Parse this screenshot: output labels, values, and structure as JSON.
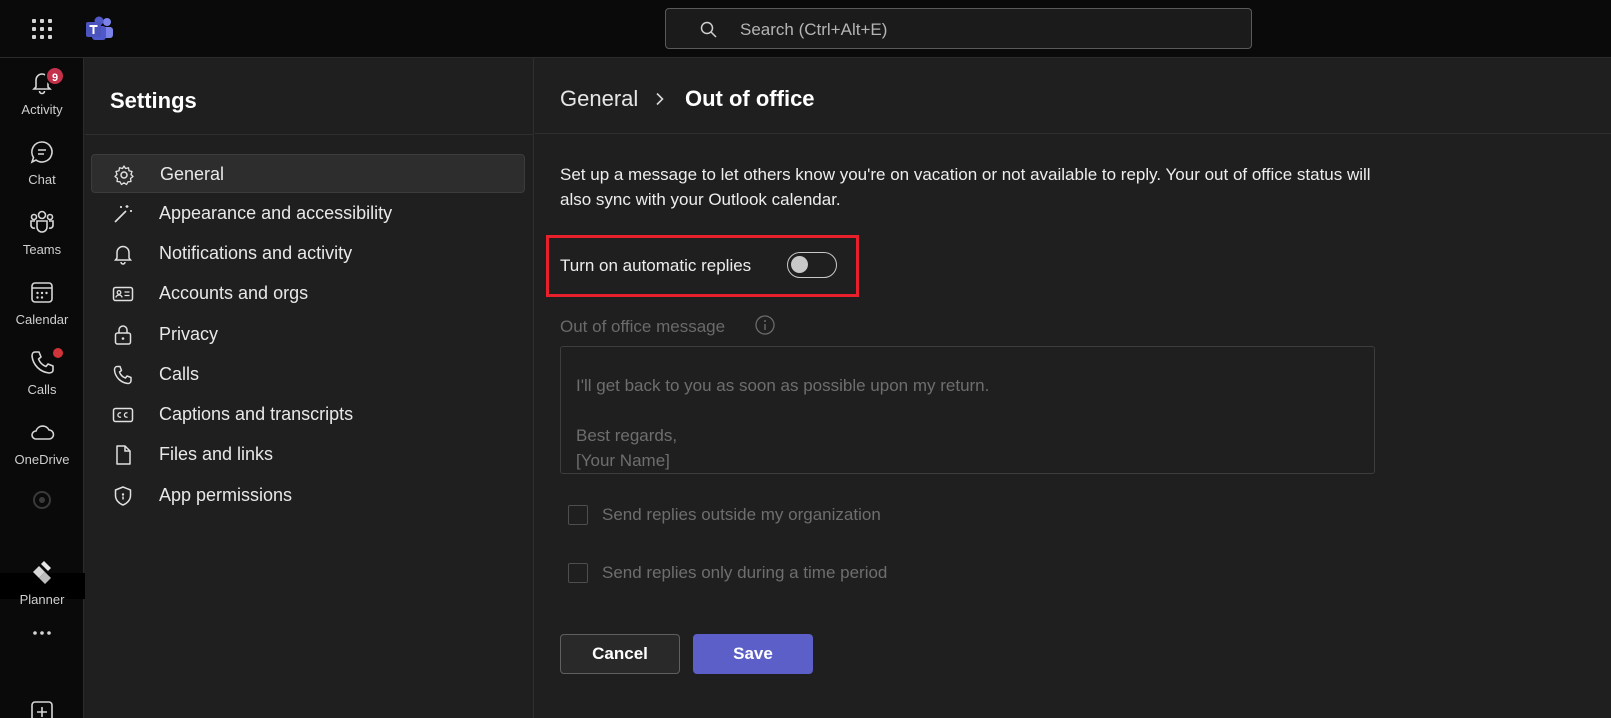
{
  "topbar": {
    "search_placeholder": "Search (Ctrl+Alt+E)"
  },
  "rail": {
    "items": [
      {
        "label": "Activity",
        "badge": "9"
      },
      {
        "label": "Chat"
      },
      {
        "label": "Teams"
      },
      {
        "label": "Calendar"
      },
      {
        "label": "Calls"
      },
      {
        "label": "OneDrive"
      },
      {
        "label": "Planner"
      }
    ]
  },
  "settings": {
    "title": "Settings",
    "items": [
      {
        "label": "General",
        "icon": "gear-icon"
      },
      {
        "label": "Appearance and accessibility",
        "icon": "wand-icon"
      },
      {
        "label": "Notifications and activity",
        "icon": "bell-icon"
      },
      {
        "label": "Accounts and orgs",
        "icon": "id-card-icon"
      },
      {
        "label": "Privacy",
        "icon": "lock-icon"
      },
      {
        "label": "Calls",
        "icon": "phone-icon"
      },
      {
        "label": "Captions and transcripts",
        "icon": "cc-icon"
      },
      {
        "label": "Files and links",
        "icon": "file-icon"
      },
      {
        "label": "App permissions",
        "icon": "shield-icon"
      }
    ]
  },
  "main": {
    "breadcrumb_parent": "General",
    "breadcrumb_current": "Out of office",
    "description": "Set up a message to let others know you're on vacation or not available to reply. Your out of office status will also sync with your Outlook calendar.",
    "toggle_label": "Turn on automatic replies",
    "toggle_on": false,
    "oof_label": "Out of office message",
    "message_text": "I'll get back to you as soon as possible upon my return.\n\nBest regards,\n[Your Name]",
    "check_outside": "Send replies outside my organization",
    "check_period": "Send replies only during a time period",
    "cancel_label": "Cancel",
    "save_label": "Save"
  },
  "colors": {
    "accent": "#5b5fc7",
    "badge": "#c4314b",
    "highlight": "#e8202b"
  }
}
